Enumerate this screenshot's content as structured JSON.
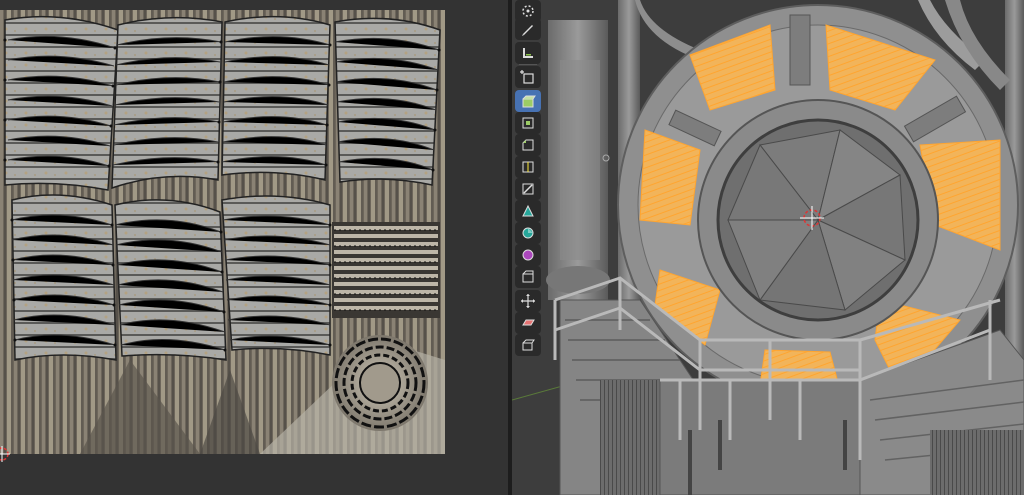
{
  "window": {
    "left_editor": "uv-editor",
    "right_editor": "3d-viewport"
  },
  "colors": {
    "editor_bg": "#333333",
    "viewport_bg": "#3d3d3d",
    "accent": "#4772b3",
    "selected_face": "#f2b45a",
    "selected_edge": "#ffa530",
    "uv_vertex": "#111111"
  },
  "uv_editor": {
    "islands": [
      {
        "id": "panel-1",
        "type": "curved-panel"
      },
      {
        "id": "panel-2",
        "type": "curved-panel"
      },
      {
        "id": "panel-3",
        "type": "curved-panel"
      },
      {
        "id": "panel-4",
        "type": "curved-panel"
      },
      {
        "id": "panel-5",
        "type": "curved-panel"
      },
      {
        "id": "panel-6",
        "type": "curved-panel"
      },
      {
        "id": "panel-7",
        "type": "curved-panel"
      },
      {
        "id": "ring-strips",
        "type": "strip-block"
      },
      {
        "id": "round-disc",
        "type": "circular"
      }
    ]
  },
  "toolbar": {
    "tools": [
      {
        "name": "cursor-tool",
        "icon": "cursor-icon",
        "active": false
      },
      {
        "name": "annotate-tool",
        "icon": "pencil-icon",
        "active": false
      },
      {
        "name": "measure-tool",
        "icon": "ruler-icon",
        "active": false
      },
      {
        "name": "add-cube-tool",
        "icon": "add-cube-icon",
        "active": false
      },
      {
        "name": "extrude-tool",
        "icon": "extrude-icon",
        "active": true
      },
      {
        "name": "inset-tool",
        "icon": "inset-icon",
        "active": false
      },
      {
        "name": "bevel-tool",
        "icon": "bevel-icon",
        "active": false
      },
      {
        "name": "loop-cut-tool",
        "icon": "loop-cut-icon",
        "active": false
      },
      {
        "name": "knife-tool",
        "icon": "knife-icon",
        "active": false
      },
      {
        "name": "poly-build-tool",
        "icon": "poly-build-icon",
        "active": false
      },
      {
        "name": "spin-tool",
        "icon": "spin-icon",
        "active": false
      },
      {
        "name": "smooth-tool",
        "icon": "smooth-icon",
        "active": false
      },
      {
        "name": "edge-slide-tool",
        "icon": "edge-slide-icon",
        "active": false
      },
      {
        "name": "shrink-fatten-tool",
        "icon": "shrink-fatten-icon",
        "active": false
      },
      {
        "name": "shear-tool",
        "icon": "shear-icon",
        "active": false
      },
      {
        "name": "rip-tool",
        "icon": "rip-icon",
        "active": false
      }
    ]
  }
}
